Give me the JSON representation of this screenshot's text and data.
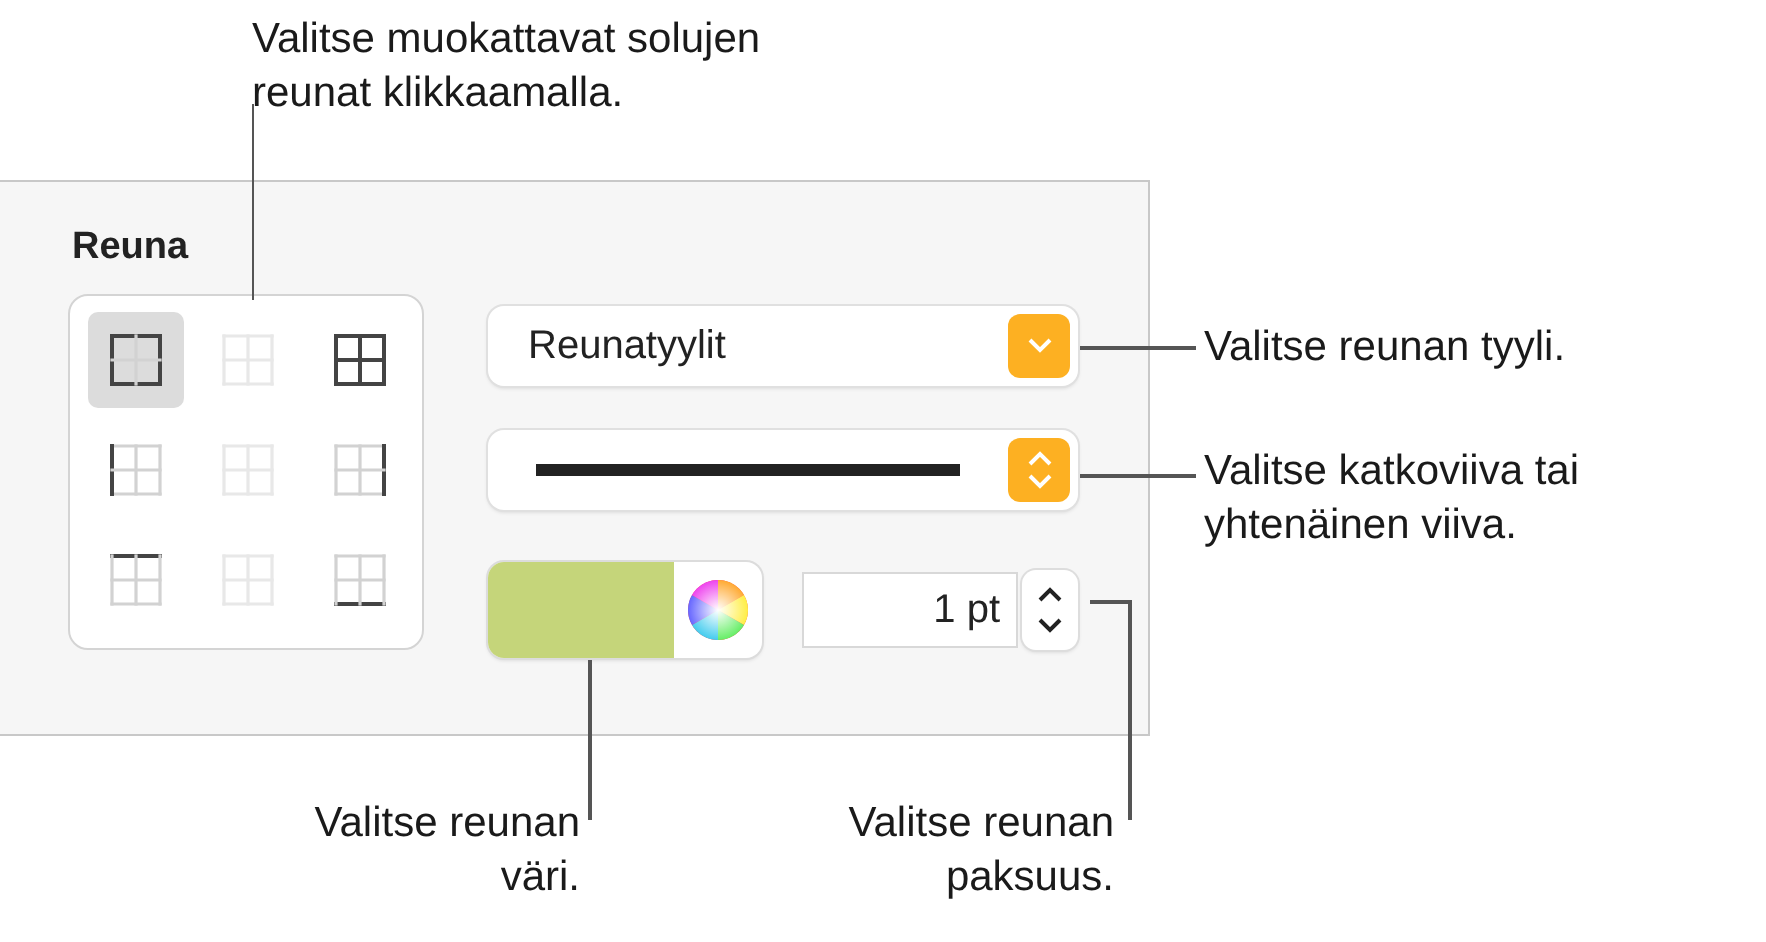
{
  "panel": {
    "title": "Reuna",
    "border_buttons": [
      {
        "kind": "outer",
        "selected": true,
        "disabled": false
      },
      {
        "kind": "inner",
        "selected": false,
        "disabled": true
      },
      {
        "kind": "all",
        "selected": false,
        "disabled": false
      },
      {
        "kind": "left",
        "selected": false,
        "disabled": false
      },
      {
        "kind": "inner-vertical",
        "selected": false,
        "disabled": true
      },
      {
        "kind": "right",
        "selected": false,
        "disabled": false
      },
      {
        "kind": "top",
        "selected": false,
        "disabled": false
      },
      {
        "kind": "inner-horizontal",
        "selected": false,
        "disabled": true
      },
      {
        "kind": "bottom",
        "selected": false,
        "disabled": false
      }
    ],
    "style_dropdown": {
      "value": "Reunatyylit"
    },
    "line_style": {
      "kind": "solid"
    },
    "color_well": {
      "color": "#c5d57a"
    },
    "width_field": {
      "value": "1 pt"
    }
  },
  "callouts": [
    {
      "kind": "border-buttons",
      "lines": [
        "Valitse muokattavat solujen",
        "reunat klikkaamalla."
      ]
    },
    {
      "kind": "style-dropdown",
      "lines": [
        "Valitse reunan tyyli."
      ]
    },
    {
      "kind": "line-style",
      "lines": [
        "Valitse katkoviiva tai",
        "yhtenäinen viiva."
      ]
    },
    {
      "kind": "color-well",
      "lines": [
        "Valitse reunan",
        "väri."
      ]
    },
    {
      "kind": "width-field",
      "lines": [
        "Valitse reunan",
        "paksuus."
      ]
    }
  ]
}
